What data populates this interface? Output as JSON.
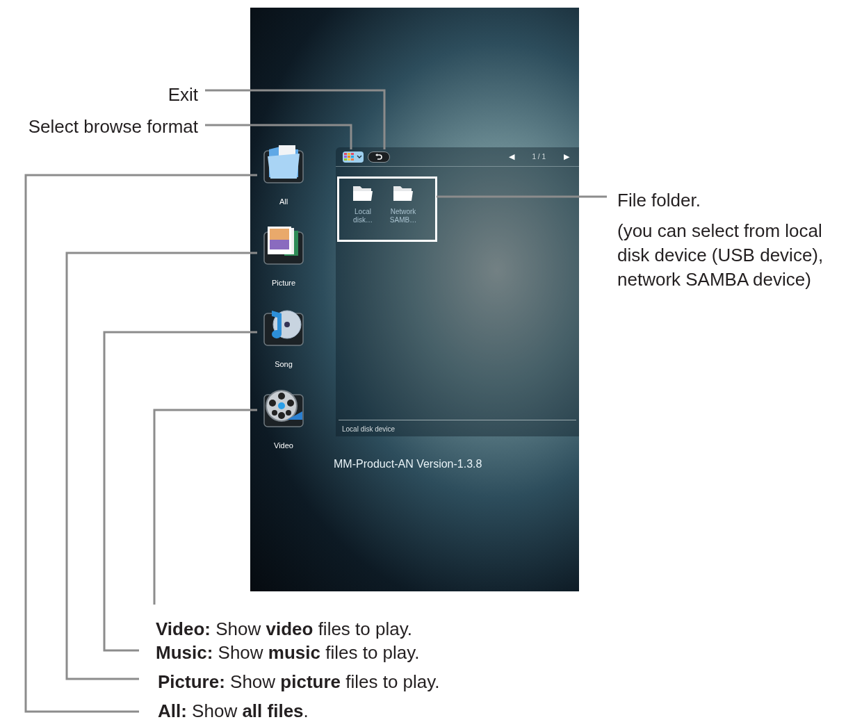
{
  "callouts": {
    "exit": "Exit",
    "browse_format": "Select browse format",
    "file_folder": "File folder.",
    "file_folder_note": "(you can select from local disk device (USB device), network SAMBA device)"
  },
  "legend": [
    {
      "kind": "video",
      "text": "**Video:** Show **video** files to play."
    },
    {
      "kind": "music",
      "text": "**Music:** Show **music** files to play."
    },
    {
      "kind": "picture",
      "text": "**Picture:** Show **picture** files to play."
    },
    {
      "kind": "all",
      "text": "**All:** Show **all files**."
    }
  ],
  "screen": {
    "categories": [
      {
        "kind": "all",
        "label": "All"
      },
      {
        "kind": "picture",
        "label": "Picture"
      },
      {
        "kind": "song",
        "label": "Song"
      },
      {
        "kind": "video",
        "label": "Video"
      }
    ],
    "toolbar": {
      "prev": "◀",
      "page": "1 / 1",
      "next": "▶"
    },
    "folders": [
      {
        "label": "Local disk…"
      },
      {
        "label": "Network SAMB…"
      }
    ],
    "status": "Local disk device",
    "version": "MM-Product-AN Version-1.3.8"
  }
}
